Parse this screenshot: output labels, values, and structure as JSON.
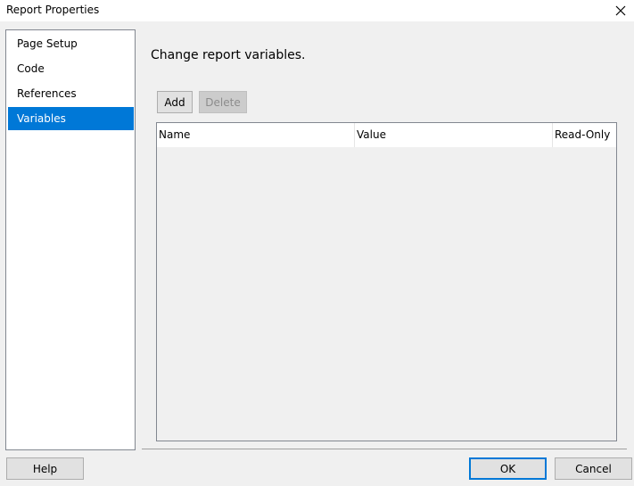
{
  "window": {
    "title": "Report Properties",
    "close_icon": "close-icon"
  },
  "sidebar": {
    "items": [
      {
        "label": "Page Setup"
      },
      {
        "label": "Code"
      },
      {
        "label": "References"
      },
      {
        "label": "Variables",
        "selected": true
      }
    ]
  },
  "main": {
    "heading": "Change report variables.",
    "add_label": "Add",
    "delete_label": "Delete",
    "table": {
      "columns": [
        "Name",
        "Value",
        "Read-Only"
      ]
    }
  },
  "footer": {
    "help_label": "Help",
    "ok_label": "OK",
    "cancel_label": "Cancel"
  },
  "colors": {
    "accent": "#0078d7",
    "background": "#f0f0f0"
  }
}
